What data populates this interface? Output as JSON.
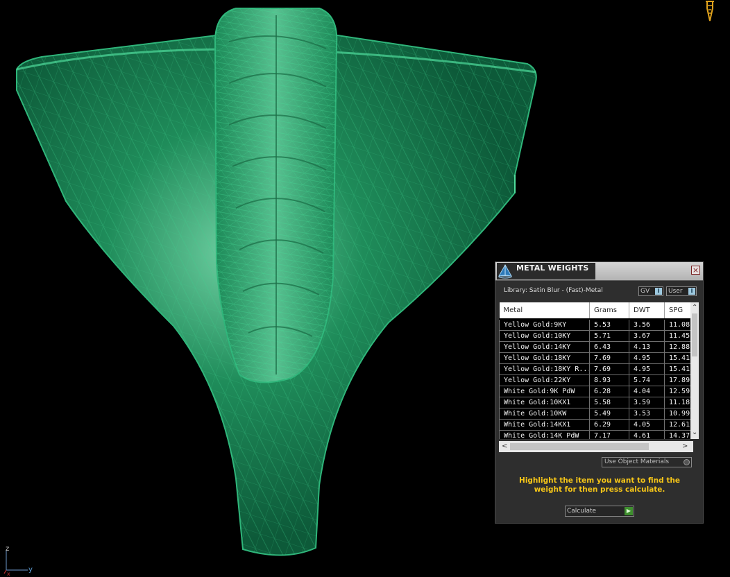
{
  "panel": {
    "title": "METAL WEIGHTS",
    "close_glyph": "×",
    "library_label": "Library: Satin Blur - (Fast)-Metal",
    "toggle_gv": "GV",
    "toggle_user": "User",
    "toggle_glyph": "I",
    "columns": [
      "Metal",
      "Grams",
      "DWT",
      "SPG"
    ],
    "rows": [
      [
        "Yellow Gold:9KY",
        "5.53",
        "3.56",
        "11.08"
      ],
      [
        "Yellow Gold:10KY",
        "5.71",
        "3.67",
        "11.45"
      ],
      [
        "Yellow Gold:14KY",
        "6.43",
        "4.13",
        "12.88"
      ],
      [
        "Yellow Gold:18KY",
        "7.69",
        "4.95",
        "15.41"
      ],
      [
        "Yellow Gold:18KY R...",
        "7.69",
        "4.95",
        "15.41"
      ],
      [
        "Yellow Gold:22KY",
        "8.93",
        "5.74",
        "17.89"
      ],
      [
        "White Gold:9K PdW",
        "6.28",
        "4.04",
        "12.59"
      ],
      [
        "White Gold:10KX1",
        "5.58",
        "3.59",
        "11.18"
      ],
      [
        "White Gold:10KW",
        "5.49",
        "3.53",
        "10.99"
      ],
      [
        "White Gold:14KX1",
        "6.29",
        "4.05",
        "12.61"
      ],
      [
        "White Gold:14K PdW",
        "7.17",
        "4.61",
        "14.37"
      ]
    ],
    "use_object_materials": "Use Object Materials",
    "instruction": "Highlight the item you want to find the weight for then press calculate.",
    "calculate": "Calculate",
    "calculate_glyph": "▶",
    "scroll_up": "⌃",
    "scroll_down": "⌄",
    "scroll_left": "<",
    "scroll_right": ">"
  },
  "axes": {
    "z": "z",
    "y": "y",
    "x": "x"
  },
  "colors": {
    "wireframe": "#2fb57a",
    "panel_bg": "#2e2e2e",
    "instruction_text": "#f5c518",
    "calculate_accent": "#3e8e2e"
  },
  "icons": {
    "tool": "dimension-tool-icon",
    "logo": "pyramid-logo-icon",
    "close": "close-icon"
  }
}
